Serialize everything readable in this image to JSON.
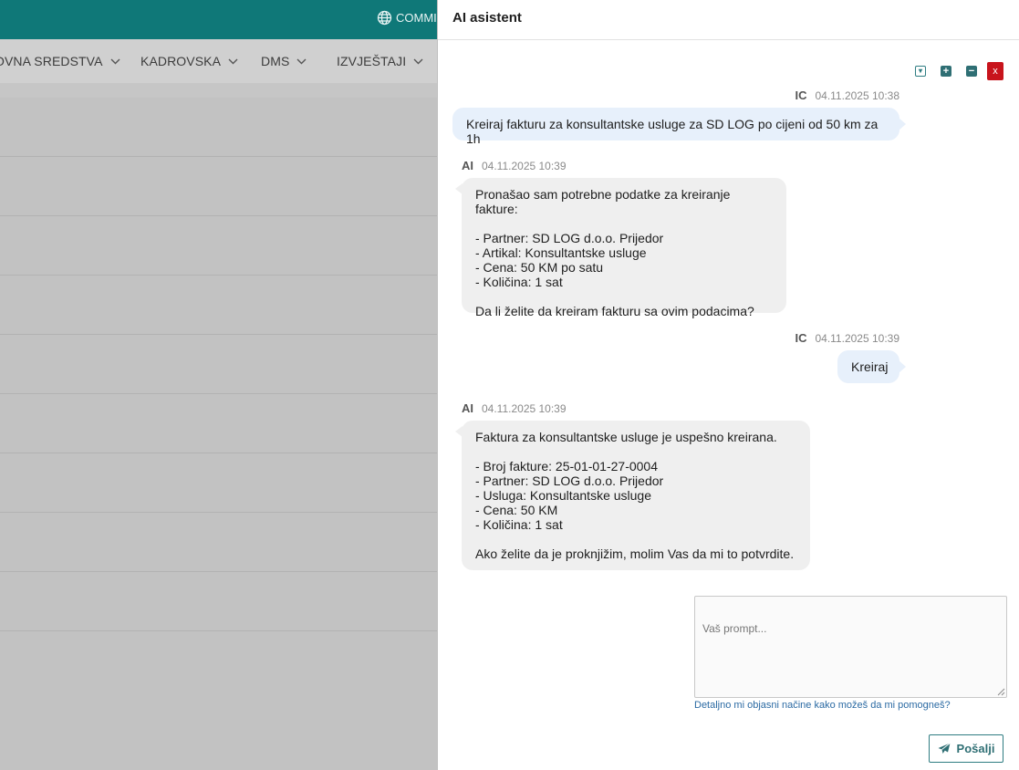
{
  "topbar": {
    "commit_label": "COMMIT",
    "icon": "globe-icon",
    "color": "#0f7878"
  },
  "nav": {
    "items": [
      {
        "label": "OVNA SREDSTVA",
        "icon": "chevron-down-icon"
      },
      {
        "label": "KADROVSKA",
        "icon": "chevron-down-icon"
      },
      {
        "label": "DMS",
        "icon": "chevron-down-icon"
      },
      {
        "label": "IZVJEŠTAJI",
        "icon": "chevron-down-icon"
      }
    ]
  },
  "panel": {
    "title": "AI asistent",
    "controls": {
      "download_icon": "download-icon",
      "expand_icon": "plus-icon",
      "collapse_icon": "minus-icon",
      "close_label": "x",
      "close_color": "#c8141c"
    },
    "messages": [
      {
        "sender": "IC",
        "timestamp": "04.11.2025 10:38",
        "role": "user",
        "text": "Kreiraj fakturu za konsultantske usluge za SD LOG po cijeni od 50 km za 1h"
      },
      {
        "sender": "AI",
        "timestamp": "04.11.2025 10:39",
        "role": "ai",
        "text": "Pronašao sam potrebne podatke za kreiranje fakture:\n\n- Partner: SD LOG d.o.o. Prijedor\n- Artikal: Konsultantske usluge\n- Cena: 50 KM po satu\n- Količina: 1 sat\n\nDa li želite da kreiram fakturu sa ovim podacima?"
      },
      {
        "sender": "IC",
        "timestamp": "04.11.2025 10:39",
        "role": "user",
        "text": "Kreiraj"
      },
      {
        "sender": "AI",
        "timestamp": "04.11.2025 10:39",
        "role": "ai",
        "text": "Faktura za konsultantske usluge je uspešno kreirana.\n\n- Broj fakture: 25-01-01-27-0004\n- Partner: SD LOG d.o.o. Prijedor\n- Usluga: Konsultantske usluge\n- Cena: 50 KM\n- Količina: 1 sat\n\nAko želite da je proknjižim, molim Vas da mi to potvrdite."
      }
    ],
    "prompt": {
      "placeholder": "Vaš prompt...",
      "value": ""
    },
    "hint_link": "Detaljno mi objasni načine kako možeš da mi pomogneš?",
    "send_button": {
      "label": "Pošalji",
      "icon": "send-icon",
      "color": "#2f7d82"
    }
  }
}
